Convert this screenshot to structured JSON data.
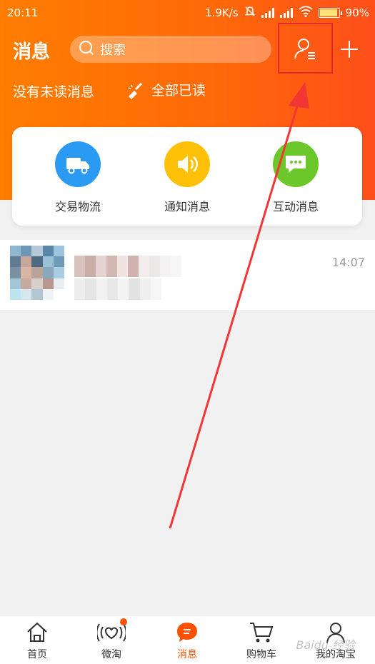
{
  "status_bar": {
    "time": "20:11",
    "speed": "1.9K/s",
    "battery": "90%"
  },
  "header": {
    "title": "消息",
    "search_placeholder": "搜索",
    "no_unread": "没有未读消息",
    "mark_all_read": "全部已读"
  },
  "categories": [
    {
      "label": "交易物流",
      "color": "#2a9af3",
      "icon": "truck-icon"
    },
    {
      "label": "通知消息",
      "color": "#ffc107",
      "icon": "speaker-icon"
    },
    {
      "label": "互动消息",
      "color": "#6cc82a",
      "icon": "chat-bubble-icon"
    }
  ],
  "messages": [
    {
      "time": "14:07"
    }
  ],
  "tabs": [
    {
      "label": "首页",
      "icon": "home-icon"
    },
    {
      "label": "微淘",
      "icon": "weitao-icon"
    },
    {
      "label": "消息",
      "icon": "message-icon",
      "active": true
    },
    {
      "label": "购物车",
      "icon": "cart-icon"
    },
    {
      "label": "我的淘宝",
      "icon": "profile-icon"
    }
  ],
  "watermark": "Baidu 经验",
  "colors": {
    "accent": "#ff5000",
    "highlight": "#e52b2b"
  }
}
